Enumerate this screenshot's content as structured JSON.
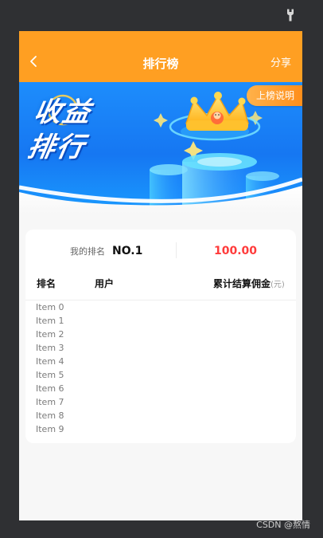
{
  "device": {
    "tool_icon": "wrench-icon"
  },
  "header": {
    "title": "排行榜",
    "share_label": "分享",
    "back_icon": "chevron-left-icon",
    "color": "#ff9f22"
  },
  "banner": {
    "title": "收益\n排行",
    "rule_button": "上榜说明",
    "art_icon": "crown-icon"
  },
  "my_rank": {
    "label": "我的排名",
    "value": "NO.1",
    "amount": "100.00",
    "amount_color": "#ff3b3b"
  },
  "table": {
    "headers": {
      "rank": "排名",
      "user": "用户",
      "amount": "累计结算佣金",
      "unit": "(元)"
    },
    "items": [
      "Item 0",
      "Item 1",
      "Item 2",
      "Item 3",
      "Item 4",
      "Item 5",
      "Item 6",
      "Item 7",
      "Item 8",
      "Item 9"
    ]
  },
  "watermark": "CSDN @熬情"
}
